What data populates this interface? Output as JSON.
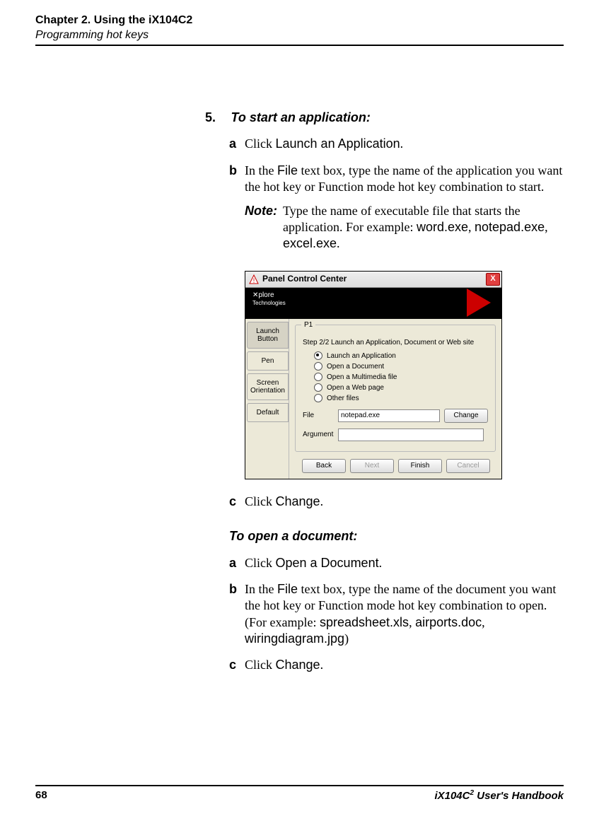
{
  "header": {
    "chapter": "Chapter 2. Using the iX104C2",
    "section": "Programming hot keys"
  },
  "step_number": "5.",
  "section1_title": "To start an application:",
  "s1a_letter": "a",
  "s1a_text1": "Click ",
  "s1a_text2": "Launch an Application",
  "s1a_text3": ".",
  "s1b_letter": "b",
  "s1b_pre": "In the ",
  "s1b_file": "File",
  "s1b_post": " text box, type the name of the application you want the hot key or Function mode hot key combination to start.",
  "note_label": "Note:",
  "note_pre": "Type the name of executable file that starts the application. For example: ",
  "note_ex1": "word.exe",
  "note_c1": ", ",
  "note_ex2": "notepad.exe",
  "note_c2": ", ",
  "note_ex3": "excel.exe",
  "note_end": ".",
  "s1c_letter": "c",
  "s1c_text1": "Click ",
  "s1c_text2": "Change",
  "s1c_text3": ".",
  "section2_title": "To open a document:",
  "s2a_letter": "a",
  "s2a_text1": "Click ",
  "s2a_text2": "Open a Document",
  "s2a_text3": ".",
  "s2b_letter": "b",
  "s2b_pre": "In the ",
  "s2b_file": "File",
  "s2b_mid": " text box, type the name of the document you want the hot key or Function mode hot key combination to open. (For example: ",
  "s2b_ex1": "spreadsheet.xls",
  "s2b_c1": ", ",
  "s2b_ex2": "airports.doc",
  "s2b_c2": ", ",
  "s2b_ex3": "wiringdiagram.jpg",
  "s2b_end": ")",
  "s2c_letter": "c",
  "s2c_text1": "Click ",
  "s2c_text2": "Change",
  "s2c_text3": ".",
  "dialog": {
    "title": "Panel Control Center",
    "tabs": [
      "Launch Button",
      "Pen",
      "Screen Orientation",
      "Default"
    ],
    "group_legend": "P1",
    "step_label": "Step 2/2    Launch an Application, Document or Web site",
    "radios": [
      "Launch an Application",
      "Open a Document",
      "Open a Multimedia file",
      "Open a Web page",
      "Other files"
    ],
    "file_label": "File",
    "file_value": "notepad.exe",
    "change_btn": "Change",
    "arg_label": "Argument",
    "arg_value": "",
    "back": "Back",
    "next": "Next",
    "finish": "Finish",
    "cancel": "Cancel",
    "close": "X"
  },
  "footer": {
    "page": "68",
    "book_pre": "iX104C",
    "book_sup": "2",
    "book_post": " User's Handbook"
  }
}
